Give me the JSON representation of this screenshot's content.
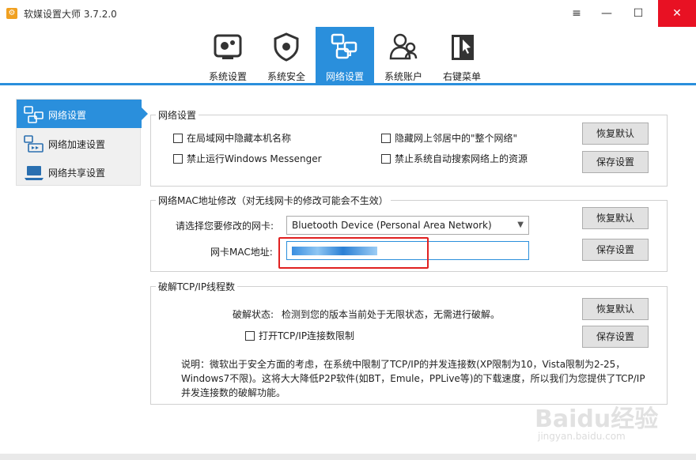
{
  "window": {
    "title": "软媒设置大师 3.7.2.0",
    "menu_icon": "≡",
    "min_icon": "—",
    "max_icon": "☐",
    "close_icon": "✕"
  },
  "toolbar": {
    "items": [
      {
        "label": "系统设置",
        "icon": "system-settings-icon"
      },
      {
        "label": "系统安全",
        "icon": "shield-icon"
      },
      {
        "label": "网络设置",
        "icon": "network-icon"
      },
      {
        "label": "系统账户",
        "icon": "users-icon"
      },
      {
        "label": "右键菜单",
        "icon": "cursor-menu-icon"
      }
    ],
    "active_index": 2
  },
  "sidebar": {
    "items": [
      {
        "label": "网络设置"
      },
      {
        "label": "网络加速设置"
      },
      {
        "label": "网络共享设置"
      }
    ],
    "active_index": 0
  },
  "network_settings": {
    "title": "网络设置",
    "options": [
      "在局域网中隐藏本机名称",
      "禁止运行Windows Messenger",
      "隐藏网上邻居中的\"整个网络\"",
      "禁止系统自动搜索网络上的资源"
    ],
    "restore_label": "恢复默认",
    "save_label": "保存设置"
  },
  "mac_settings": {
    "title": "网络MAC地址修改（对无线网卡的修改可能会不生效）",
    "adapter_label": "请选择您要修改的网卡:",
    "adapter_value": "Bluetooth Device (Personal Area Network)",
    "mac_label": "网卡MAC地址:",
    "restore_label": "恢复默认",
    "save_label": "保存设置"
  },
  "tcp_settings": {
    "title": "破解TCP/IP线程数",
    "status_label": "破解状态:",
    "status_value": "检测到您的版本当前处于无限状态，无需进行破解。",
    "open_limit_label": "打开TCP/IP连接数限制",
    "restore_label": "恢复默认",
    "save_label": "保存设置",
    "note_line1": "说明：微软出于安全方面的考虑，在系统中限制了TCP/IP的并发连接数(XP限制为10，Vista限制为2-25，",
    "note_line2": "Windows7不限)。这将大大降低P2P软件(如BT，Emule，PPLive等)的下载速度，所以我们为您提供了TCP/IP",
    "note_line3": "并发连接数的破解功能。"
  },
  "watermark": {
    "brand": "Baidu经验",
    "url": "jingyan.baidu.com"
  },
  "colors": {
    "accent": "#2a8fdc",
    "highlight_border": "#e02020",
    "close_bg": "#e81123"
  }
}
